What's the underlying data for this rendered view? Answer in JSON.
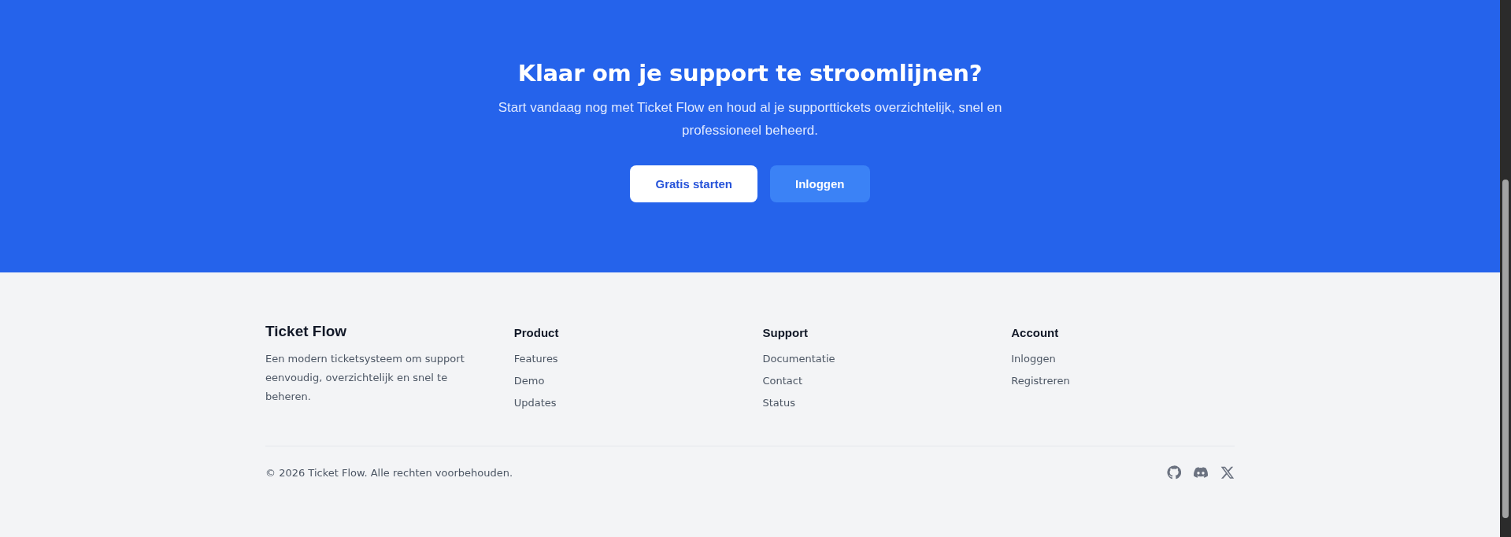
{
  "cta": {
    "title": "Klaar om je support te stroomlijnen?",
    "subtitle": "Start vandaag nog met Ticket Flow en houd al je supporttickets overzichtelijk, snel en professioneel beheerd.",
    "buttons": [
      {
        "label": "Gratis starten",
        "kind": "primary"
      },
      {
        "label": "Inloggen",
        "kind": "secondary"
      }
    ]
  },
  "footer": {
    "brand": {
      "name": "Ticket Flow",
      "description": "Een modern ticketsysteem om support eenvoudig, overzichtelijk en snel te beheren."
    },
    "columns": [
      {
        "heading": "Product",
        "links": [
          "Features",
          "Demo",
          "Updates"
        ]
      },
      {
        "heading": "Support",
        "links": [
          "Documentatie",
          "Contact",
          "Status"
        ]
      },
      {
        "heading": "Account",
        "links": [
          "Inloggen",
          "Registreren"
        ]
      }
    ],
    "copyright": "© 2026 Ticket Flow. Alle rechten voorbehouden.",
    "social": [
      {
        "kind": "github"
      },
      {
        "kind": "discord"
      },
      {
        "kind": "x"
      }
    ]
  }
}
